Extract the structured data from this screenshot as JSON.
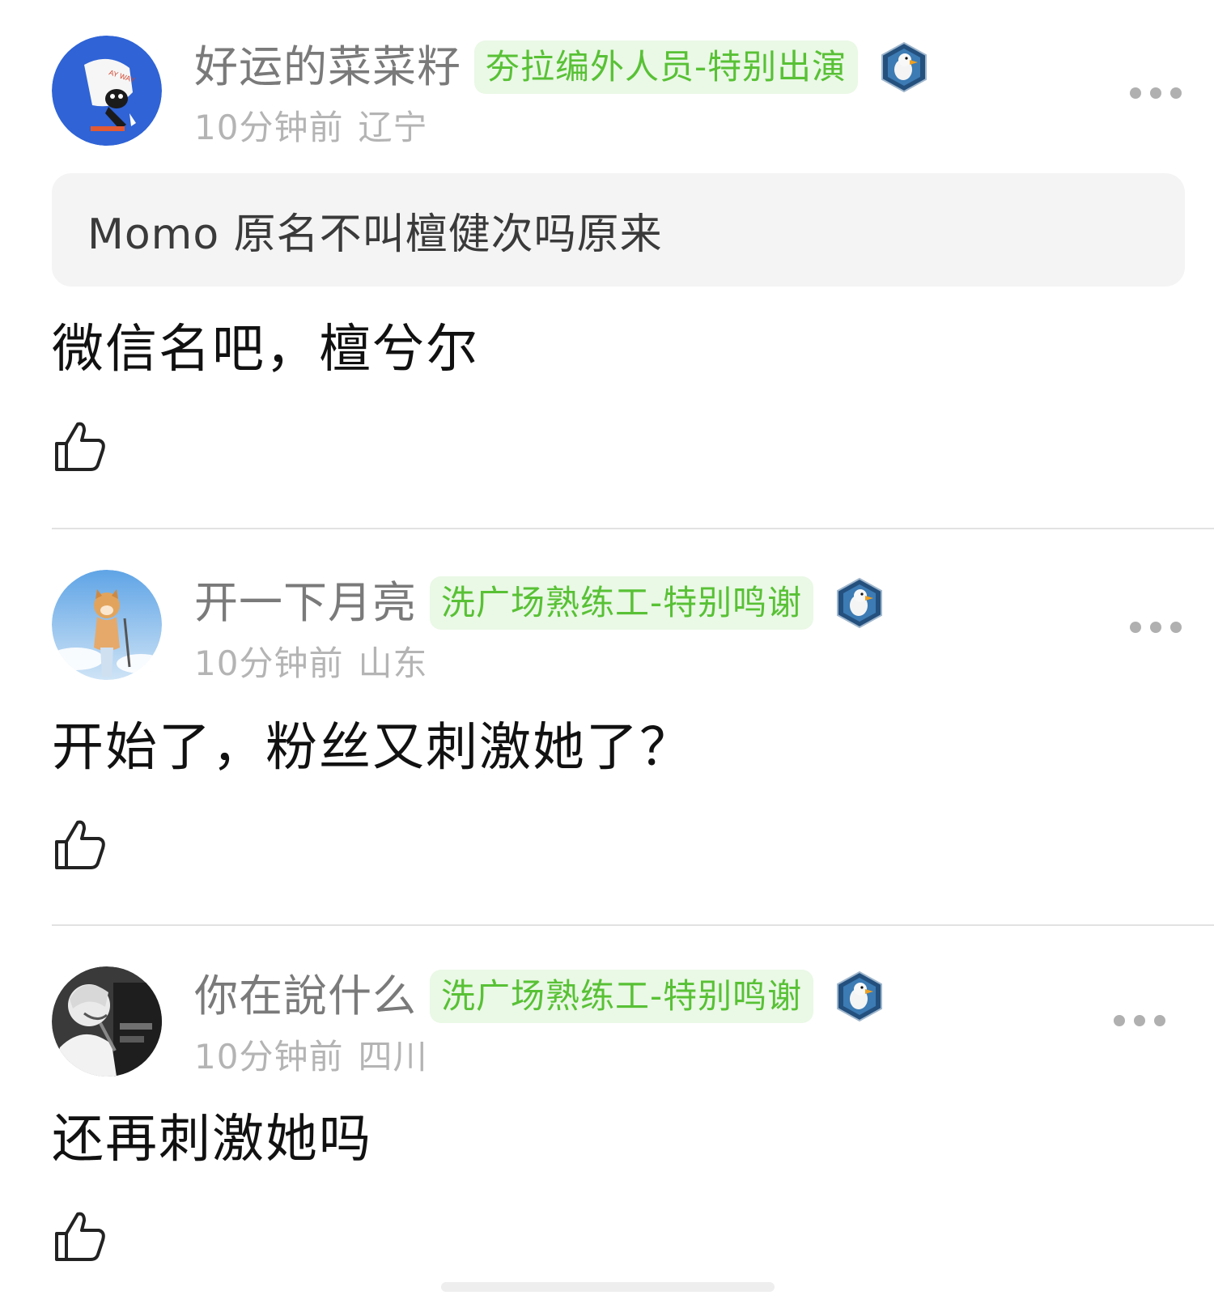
{
  "comments": [
    {
      "username": "好运的菜菜籽",
      "badge": "夯拉编外人员-特别出演",
      "time": "10分钟前",
      "location": "辽宁",
      "quote": "Momo 原名不叫檀健次吗原来",
      "text": "微信名吧，檀兮尔"
    },
    {
      "username": "开一下月亮",
      "badge": "洗广场熟练工-特别鸣谢",
      "time": "10分钟前",
      "location": "山东",
      "text": "开始了，粉丝又刺激她了？"
    },
    {
      "username": "你在說什么",
      "badge": "洗广场熟练工-特别鸣谢",
      "time": "10分钟前",
      "location": "四川",
      "text": "还再刺激她吗"
    }
  ],
  "colors": {
    "badge_bg": "#eaf8e6",
    "badge_text": "#58c135",
    "username": "#7a7a7a",
    "meta": "#b4b4b4",
    "quote_bg": "#f4f4f4"
  },
  "icons": {
    "level": "duck-hexagon-icon",
    "like": "thumbs-up-icon",
    "more": "more-dots-icon"
  }
}
